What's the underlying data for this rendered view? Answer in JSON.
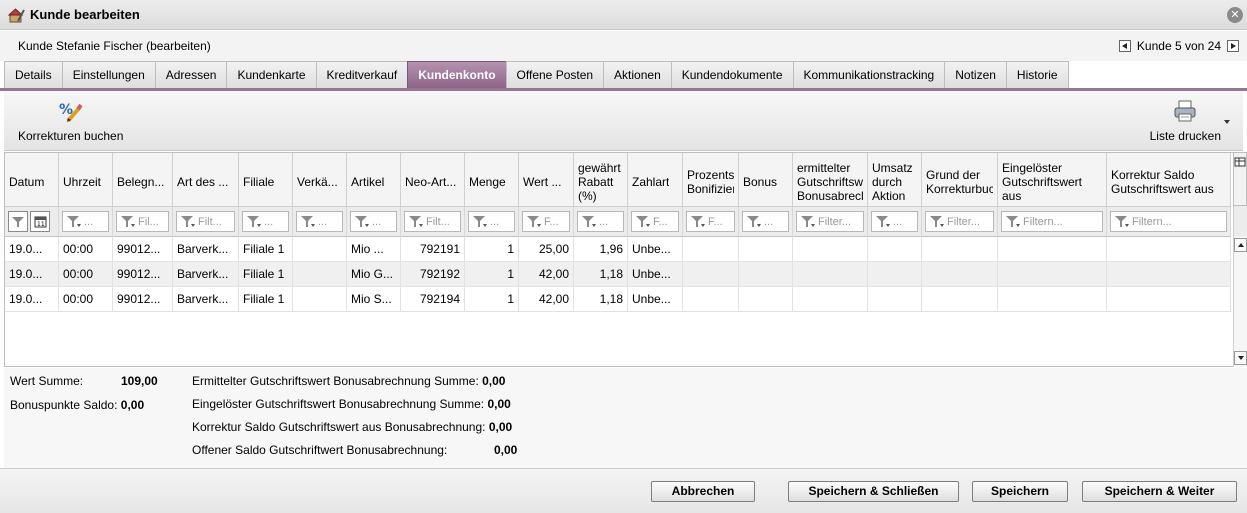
{
  "window": {
    "title": "Kunde bearbeiten"
  },
  "subheader": {
    "subtitle": "Kunde Stefanie Fischer (bearbeiten)",
    "nav_text": "Kunde 5 von 24"
  },
  "tabs": [
    {
      "label": "Details"
    },
    {
      "label": "Einstellungen"
    },
    {
      "label": "Adressen"
    },
    {
      "label": "Kundenkarte"
    },
    {
      "label": "Kreditverkauf"
    },
    {
      "label": "Kundenkonto"
    },
    {
      "label": "Offene Posten"
    },
    {
      "label": "Aktionen"
    },
    {
      "label": "Kundendokumente"
    },
    {
      "label": "Kommunikationstracking"
    },
    {
      "label": "Notizen"
    },
    {
      "label": "Historie"
    }
  ],
  "active_tab": "Kundenkonto",
  "toolbar": {
    "korrekturen_label": "Korrekturen buchen",
    "print_label": "Liste drucken"
  },
  "grid": {
    "columns": [
      {
        "label": "Datum",
        "filter": ""
      },
      {
        "label": "Uhrzeit",
        "filter": "..."
      },
      {
        "label": "Belegn...",
        "filter": "Fil..."
      },
      {
        "label": "Art des ...",
        "filter": "Filt..."
      },
      {
        "label": "Filiale",
        "filter": "..."
      },
      {
        "label": "Verkä...",
        "filter": "..."
      },
      {
        "label": "Artikel",
        "filter": "..."
      },
      {
        "label": "Neo-Art...",
        "filter": "Filt..."
      },
      {
        "label": "Menge",
        "filter": "..."
      },
      {
        "label": "Wert ...",
        "filter": "F..."
      },
      {
        "label": "gewährt Rabatt (%)",
        "filter": "..."
      },
      {
        "label": "Zahlart",
        "filter": "F..."
      },
      {
        "label": "Prozents Bonifizier",
        "filter": "F..."
      },
      {
        "label": "Bonus",
        "filter": "..."
      },
      {
        "label": "ermittelter Gutschriftsw Bonusabrech",
        "filter": "Filter..."
      },
      {
        "label": "Umsatz durch Aktion",
        "filter": "..."
      },
      {
        "label": "Grund der Korrekturbuc",
        "filter": "Filter..."
      },
      {
        "label": "Eingelöster Gutschriftswert aus",
        "filter": "Filtern..."
      },
      {
        "label": "Korrektur Saldo Gutschriftswert aus",
        "filter": "Filtern..."
      }
    ],
    "rows": [
      [
        "19.0...",
        "00:00",
        "99012...",
        "Barverk...",
        "Filiale 1",
        "",
        "Mio ...",
        "792191",
        "1",
        "25,00",
        "1,96",
        "Unbe...",
        "",
        "",
        "",
        "",
        "",
        "",
        ""
      ],
      [
        "19.0...",
        "00:00",
        "99012...",
        "Barverk...",
        "Filiale 1",
        "",
        "Mio G...",
        "792192",
        "1",
        "42,00",
        "1,18",
        "Unbe...",
        "",
        "",
        "",
        "",
        "",
        "",
        ""
      ],
      [
        "19.0...",
        "00:00",
        "99012...",
        "Barverk...",
        "Filiale 1",
        "",
        "Mio S...",
        "792194",
        "1",
        "42,00",
        "1,18",
        "Unbe...",
        "",
        "",
        "",
        "",
        "",
        "",
        ""
      ]
    ]
  },
  "summary": {
    "wert_summe_label": "Wert Summe:",
    "wert_summe_value": "109,00",
    "bonuspunkte_label": "Bonuspunkte Saldo:",
    "bonuspunkte_value": "0,00",
    "ermittelter_label": "Ermittelter Gutschriftswert Bonusabrechnung Summe:",
    "ermittelter_value": "0,00",
    "eingeloester_label": "Eingelöster Gutschriftswert Bonusabrechnung Summe:",
    "eingeloester_value": "0,00",
    "korrektur_label": "Korrektur Saldo Gutschriftswert aus Bonusabrechnung:",
    "korrektur_value": "0,00",
    "offener_label": "Offener Saldo Gutschriftwert Bonusabrechnung:",
    "offener_value": "0,00"
  },
  "footer": {
    "abbrechen": "Abbrechen",
    "speichern_schliessen": "Speichern & Schließen",
    "speichern": "Speichern",
    "speichern_weiter": "Speichern & Weiter"
  },
  "colors": {
    "active_tab": "#8e6389",
    "tab_line": "#9a7595"
  }
}
